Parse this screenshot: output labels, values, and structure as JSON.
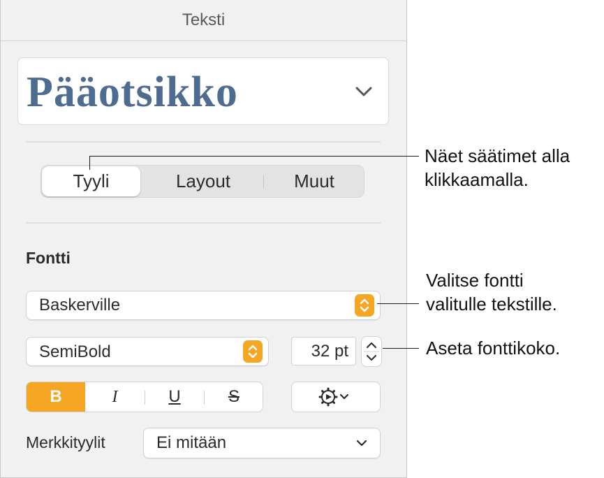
{
  "panel": {
    "title": "Teksti"
  },
  "paragraph_style": {
    "name": "Pääotsikko",
    "chevron_icon": "chevron-down-icon"
  },
  "tabs": [
    {
      "label": "Tyyli",
      "active": true
    },
    {
      "label": "Layout",
      "active": false
    },
    {
      "label": "Muut",
      "active": false
    }
  ],
  "font_section": {
    "label": "Fontti",
    "font_family": "Baskerville",
    "typeface": "SemiBold",
    "size": "32 pt",
    "format_buttons": [
      {
        "label": "B",
        "active": true
      },
      {
        "label": "I",
        "active": false
      },
      {
        "label": "U",
        "active": false
      },
      {
        "label": "S",
        "active": false
      }
    ],
    "options_icon": "gear-icon"
  },
  "character_styles": {
    "label": "Merkkityylit",
    "value": "Ei mitään"
  },
  "callouts": {
    "tabs": [
      "Näet säätimet alla",
      "klikkaamalla."
    ],
    "font": [
      "Valitse fontti",
      "valitulle tekstille."
    ],
    "size": [
      "Aseta fonttikoko."
    ]
  },
  "colors": {
    "accent": "#f5a623",
    "style_text": "#4d6c8f",
    "panel_bg": "#f1f1f1"
  }
}
